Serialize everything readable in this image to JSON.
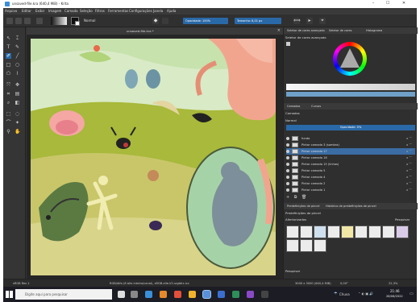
{
  "window": {
    "title": "unsaved-file.kra (640,4 MiB) - Krita",
    "minimize": "–",
    "close": "✕"
  },
  "menu": [
    "Arquivo",
    "Editar",
    "Exibir",
    "Imagem",
    "Camada",
    "Seleção",
    "Filtros",
    "Ferramentas",
    "Configurações",
    "Janela",
    "Ajuda"
  ],
  "toolbar": {
    "blend_mode": "Normal",
    "opacity_label": "Opacidade: 100%",
    "size_label": "Tamanho: 8,01 px"
  },
  "document_tab": {
    "label": "unsaved-file.kra *",
    "close": "×"
  },
  "docker": {
    "tabs": [
      "Seletor de cores avançado",
      "Seletor de cores",
      "Histograma"
    ],
    "color_selector_heading": "Seletor de cores avançado",
    "layers_tabs": [
      "Camadas",
      "Curvas"
    ],
    "layers_heading": "Camadas",
    "layer_blend": "Normal",
    "layer_opacity": "Opacidade: 0%",
    "layers": [
      {
        "name": "fundo",
        "indicator": "α ⌒"
      },
      {
        "name": "Pintar camada 3 (sombra)",
        "indicator": "α ⌒"
      },
      {
        "name": "Pintar camada 17",
        "indicator": "α ⌒"
      },
      {
        "name": "Pintar camada 16",
        "indicator": "α ⌒"
      },
      {
        "name": "Pintar camada 15 (linhas)",
        "indicator": "α ⌒"
      },
      {
        "name": "Pintar camada 5",
        "indicator": "α ⌒"
      },
      {
        "name": "Pintar camada 4",
        "indicator": "α ⌒"
      },
      {
        "name": "Pintar camada 2",
        "indicator": "α ⌒"
      },
      {
        "name": "Pintar camada 1",
        "indicator": "α ⌒"
      }
    ],
    "presets_tabs": [
      "Predefinições de pincel",
      "Histórico de predefinições de pincel"
    ],
    "presets_heading": "Predefinições de pincel",
    "presets_filter": "Alteriorizados",
    "presets_search": "Pesquisar",
    "presets_footer": "Pesquisar"
  },
  "statusbar": {
    "left": "sRGB Rec.1",
    "center": "RGB/Alfa (8 bits inteiro/canal), sRGB-elle-V2-srgbtrc.icc",
    "size": "3000 x 3000 (640,4 MiB)",
    "angle": "0,00°",
    "zoom": "22,3%"
  },
  "taskbar": {
    "search_placeholder": "Digite aqui para pesquisar",
    "weather": "Chuva",
    "time": "21:46",
    "date": "28/06/2022"
  },
  "colors": {
    "accent": "#2a69a8",
    "canvas_bg": "#d9dd8f",
    "selected_layer": "#3b6ca3"
  }
}
